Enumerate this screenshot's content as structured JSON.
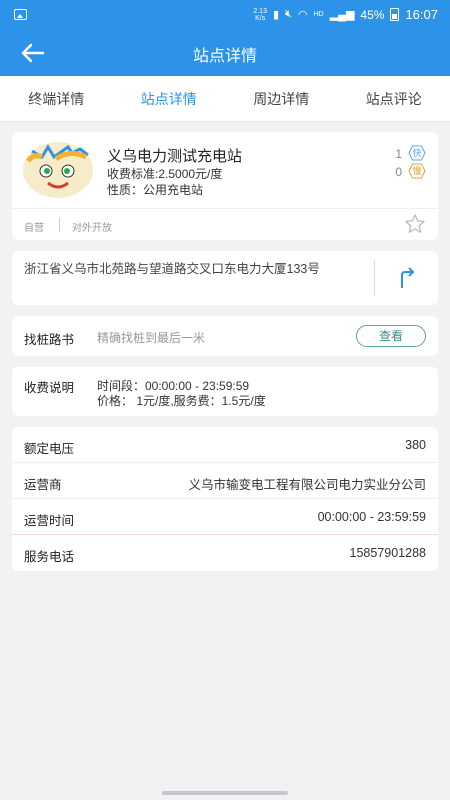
{
  "status_bar": {
    "speed_top": "2.13",
    "speed_bottom": "K/s",
    "network": "HD",
    "battery": "45%",
    "time": "16:07",
    "icons": [
      "image-icon",
      "vibrate-icon",
      "mute-icon",
      "wifi-icon",
      "signal-icon",
      "battery-icon"
    ]
  },
  "header": {
    "title": "站点详情",
    "back_icon": "arrow-left-icon"
  },
  "tabs": [
    {
      "label": "终端详情",
      "active": false
    },
    {
      "label": "站点详情",
      "active": true
    },
    {
      "label": "周边详情",
      "active": false
    },
    {
      "label": "站点评论",
      "active": false
    }
  ],
  "station": {
    "name": "义乌电力测试充电站",
    "fee": "收费标准:2.5000元/度",
    "nature": "性质：公用充电站",
    "fast_count": "1",
    "fast_label": "快",
    "slow_count": "0",
    "slow_label": "慢",
    "tags": [
      "自营",
      "对外开放"
    ],
    "favorite_icon": "star-outline-icon"
  },
  "address": {
    "text": "浙江省义乌市北苑路与望道路交叉口东电力大厦133号",
    "route_icon": "route-icon"
  },
  "guide": {
    "label": "找桩路书",
    "desc": "精确找桩到最后一米",
    "button": "查看"
  },
  "pricing": {
    "label": "收费说明",
    "line1": "时间段：00:00:00 - 23:59:59",
    "line2": "价格：  1元/度,服务费：1.5元/度"
  },
  "details": [
    {
      "key": "额定电压",
      "value": "380"
    },
    {
      "key": "运营商",
      "value": "义乌市输变电工程有限公司电力实业分公司"
    },
    {
      "key": "运营时间",
      "value": "00:00:00 - 23:59:59"
    },
    {
      "key": "服务电话",
      "value": "15857901288"
    }
  ],
  "colors": {
    "brand": "#2d93e8",
    "background": "#f2f2f4",
    "button_border": "#58a89a"
  }
}
